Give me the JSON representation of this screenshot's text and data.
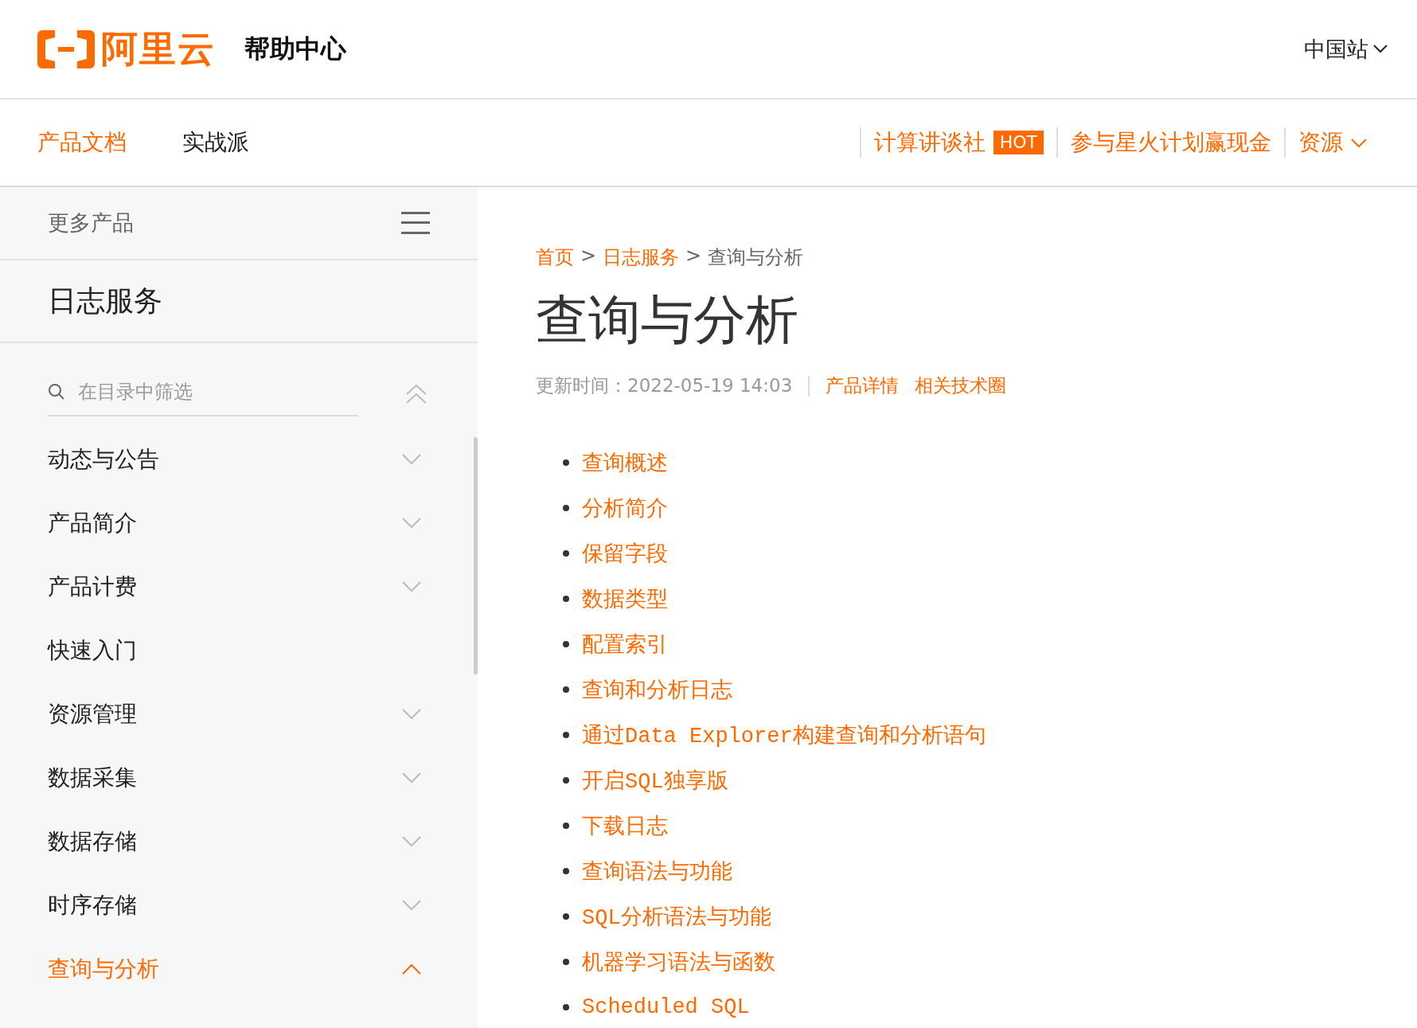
{
  "header": {
    "logo_text": "阿里云",
    "site_title": "帮助中心",
    "region": "中国站"
  },
  "nav": {
    "tabs": [
      {
        "label": "产品文档",
        "selected": true
      },
      {
        "label": "实战派",
        "selected": false
      }
    ],
    "links": [
      {
        "label": "计算讲谈社",
        "badge": "HOT"
      },
      {
        "label": "参与星火计划赢现金"
      },
      {
        "label": "资源",
        "dropdown": true
      }
    ]
  },
  "sidebar": {
    "more_products": "更多产品",
    "product": "日志服务",
    "filter": {
      "placeholder": "在目录中筛选"
    },
    "items": [
      {
        "label": "动态与公告",
        "kind": "group",
        "expanded": false,
        "selected": false
      },
      {
        "label": "产品简介",
        "kind": "group",
        "expanded": false,
        "selected": false
      },
      {
        "label": "产品计费",
        "kind": "group",
        "expanded": false,
        "selected": false
      },
      {
        "label": "快速入门",
        "kind": "leaf",
        "selected": false
      },
      {
        "label": "资源管理",
        "kind": "group",
        "expanded": false,
        "selected": false
      },
      {
        "label": "数据采集",
        "kind": "group",
        "expanded": false,
        "selected": false
      },
      {
        "label": "数据存储",
        "kind": "group",
        "expanded": false,
        "selected": false
      },
      {
        "label": "时序存储",
        "kind": "group",
        "expanded": false,
        "selected": false
      },
      {
        "label": "查询与分析",
        "kind": "group",
        "expanded": true,
        "selected": true
      }
    ]
  },
  "content": {
    "breadcrumb": [
      {
        "label": "首页",
        "link": true
      },
      {
        "separator": ">",
        "label": "日志服务",
        "link": true
      },
      {
        "separator": ">",
        "label": "查询与分析",
        "link": false
      }
    ],
    "title": "查询与分析",
    "updated": "更新时间：2022-05-19 14:03",
    "meta_links": [
      "产品详情",
      "相关技术圈"
    ],
    "links": [
      "查询概述",
      "分析简介",
      "保留字段",
      "数据类型",
      "配置索引",
      "查询和分析日志",
      "通过Data Explorer构建查询和分析语句",
      "开启SQL独享版",
      "下载日志",
      "查询语法与功能",
      "SQL分析语法与功能",
      "机器学习语法与函数",
      "Scheduled SQL"
    ]
  }
}
